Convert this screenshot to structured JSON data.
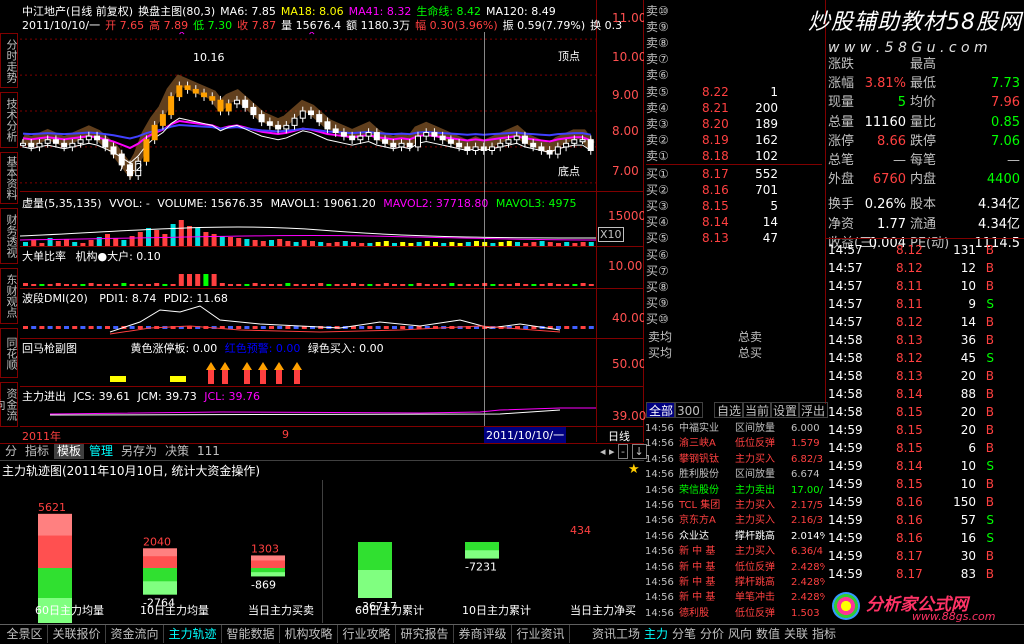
{
  "colors": {
    "up": "#ff4040",
    "down": "#00e0e0",
    "green": "#00ff00",
    "yellow": "#ffff00",
    "white": "#ffffff",
    "grid": "#800000",
    "magenta": "#ff00ff"
  },
  "watermark": {
    "text1": "炒股辅助教材",
    "text2": "58股网",
    "url": "w w w . 5 8 G u . c o m"
  },
  "logo": {
    "text": "分析家公式网",
    "url": "www.88gs.com"
  },
  "header": {
    "line1": [
      {
        "t": "中江地产(日线 前复权)",
        "c": "#ffffff"
      },
      {
        "t": "换盘主图(80,3)",
        "c": "#ffffff"
      },
      {
        "t": "MA6: 7.85",
        "c": "#ffffff"
      },
      {
        "t": "MA18: 8.06",
        "c": "#ffff00"
      },
      {
        "t": "MA41: 8.32",
        "c": "#ff00ff"
      },
      {
        "t": "生命线: 8.42",
        "c": "#00ff00"
      },
      {
        "t": "MA120: 8.49",
        "c": "#ffffff"
      }
    ],
    "line2": [
      {
        "t": "2011/10/10/一",
        "c": "#ffffff"
      },
      {
        "t": "开 7.65",
        "c": "#ff4040"
      },
      {
        "t": "高 7.89",
        "c": "#ff4040"
      },
      {
        "t": "低 7.30",
        "c": "#00ff00"
      },
      {
        "t": "收 7.87",
        "c": "#ff4040"
      },
      {
        "t": "量 15676.4",
        "c": "#ffffff"
      },
      {
        "t": "额 1180.3万",
        "c": "#ffffff"
      },
      {
        "t": "幅 0.30(3.96%)",
        "c": "#ff4040"
      },
      {
        "t": "振 0.59(7.79%)",
        "c": "#ffffff"
      },
      {
        "t": "换 0.3",
        "c": "#ffffff"
      }
    ]
  },
  "main_chart": {
    "high_label": "10.16",
    "low_label": "7.12",
    "top_label": "顶点",
    "bottom_label": "底点",
    "scale": [
      "11.00",
      "10.00",
      "9.00",
      "8.00",
      "7.00"
    ]
  },
  "left_tabs": [
    "分时走势",
    "技术分析",
    "基本资料",
    "财务透视",
    "东财观点",
    "同花顺",
    "资金流向"
  ],
  "vol_panel": {
    "title": "虚量(5,35,135)",
    "vol": "VVOL: -",
    "volume": "VOLUME: 15676.35",
    "mav1": "MAVOL1: 19061.20",
    "mav2": "MAVOL2: 37718.80",
    "mav3": "MAVOL3: 4975",
    "scale": "15000",
    "x10": "X10"
  },
  "big_panel": {
    "title": "大单比率",
    "sub": "机构●大户: 0.10",
    "scale": "10.00"
  },
  "dmi_panel": {
    "title": "波段DMI(20)",
    "pdi1": "PDI1: 8.74",
    "pdi2": "PDI2: 11.68",
    "scale": "40.00"
  },
  "horse_panel": {
    "title": "回马枪副图",
    "yellow": "黄色涨停板: 0.00",
    "red": "红色预警: 0.00",
    "green": "绿色买入: 0.00",
    "scale": "50.00"
  },
  "main_flow": {
    "title": "主力进出",
    "jcs": "JCS: 39.61",
    "jcm": "JCM: 39.73",
    "jcl": "JCL: 39.76",
    "scale": "39.00"
  },
  "date_bar": {
    "start": "2011年",
    "mid": "9",
    "end": "2011/10/10/一",
    "period": "日线"
  },
  "bottom_tabs": [
    {
      "t": "分",
      "c": "#c0c0c0"
    },
    {
      "t": "指标",
      "c": "#c0c0c0"
    },
    {
      "t": "模板",
      "c": "#ffffff",
      "bg": "#404040"
    },
    {
      "t": "管理",
      "c": "#00ffff"
    },
    {
      "t": "另存为",
      "c": "#c0c0c0"
    },
    {
      "t": "决策",
      "c": "#c0c0c0"
    },
    {
      "t": "111",
      "c": "#c0c0c0"
    }
  ],
  "flow_panel": {
    "title": "主力轨迹图(2011年10月10日, 统计大资金操作)"
  },
  "chart_data": [
    {
      "type": "bar",
      "categories": [
        "60日主力均量",
        "10日主力均量",
        "当日主力买卖"
      ],
      "series": [
        {
          "values": [
            5621,
            2040,
            1303
          ]
        },
        {
          "values": [
            -6233,
            -2764,
            -869
          ]
        }
      ]
    },
    {
      "type": "bar",
      "categories": [
        "60日主力累计",
        "10日主力累计",
        "当日主力净买"
      ],
      "series": [
        {
          "values": [
            0,
            0,
            434
          ]
        },
        {
          "values": [
            -36717,
            -7231,
            0
          ]
        }
      ]
    }
  ],
  "bottom_nav": [
    "全景区",
    "关联报价",
    "资金流向",
    "主力轨迹",
    "智能数据",
    "机构攻略",
    "行业攻略",
    "研究报告",
    "券商评级",
    "行业资讯"
  ],
  "bottom_nav_right": [
    "资讯工场",
    "主力",
    "分笔",
    "分价",
    "风向",
    "数值",
    "关联",
    "指标"
  ],
  "order_book": {
    "sell": [
      {
        "l": "卖⑩",
        "p": "",
        "v": ""
      },
      {
        "l": "卖⑨",
        "p": "",
        "v": ""
      },
      {
        "l": "卖⑧",
        "p": "",
        "v": ""
      },
      {
        "l": "卖⑦",
        "p": "",
        "v": ""
      },
      {
        "l": "卖⑥",
        "p": "",
        "v": ""
      },
      {
        "l": "卖⑤",
        "p": "8.22",
        "v": "1"
      },
      {
        "l": "卖④",
        "p": "8.21",
        "v": "200"
      },
      {
        "l": "卖③",
        "p": "8.20",
        "v": "189"
      },
      {
        "l": "卖②",
        "p": "8.19",
        "v": "162"
      },
      {
        "l": "卖①",
        "p": "8.18",
        "v": "102"
      }
    ],
    "buy": [
      {
        "l": "买①",
        "p": "8.17",
        "v": "552"
      },
      {
        "l": "买②",
        "p": "8.16",
        "v": "701"
      },
      {
        "l": "买③",
        "p": "8.15",
        "v": "5"
      },
      {
        "l": "买④",
        "p": "8.14",
        "v": "14"
      },
      {
        "l": "买⑤",
        "p": "8.13",
        "v": "47"
      },
      {
        "l": "买⑥",
        "p": "",
        "v": ""
      },
      {
        "l": "买⑦",
        "p": "",
        "v": ""
      },
      {
        "l": "买⑧",
        "p": "",
        "v": ""
      },
      {
        "l": "买⑨",
        "p": "",
        "v": ""
      },
      {
        "l": "买⑩",
        "p": "",
        "v": ""
      }
    ],
    "avg_sell": "卖均",
    "total_sell": "总卖",
    "avg_buy": "买均",
    "total_buy": "总买"
  },
  "news_tabs": [
    "全部",
    "300",
    "自选",
    "当前",
    "设置",
    "浮出"
  ],
  "news": [
    {
      "t": "14:56",
      "n": "中福实业",
      "s": "区间放量",
      "v": "6.000",
      "c": "#c0c0c0"
    },
    {
      "t": "14:56",
      "n": "渝三峡A",
      "s": "低位反弹",
      "v": "1.579",
      "c": "#ff4040"
    },
    {
      "t": "14:56",
      "n": "攀钢钒钛",
      "s": "主力买入",
      "v": "6.82/3",
      "c": "#ff4040"
    },
    {
      "t": "14:56",
      "n": "胜利股份",
      "s": "区间放量",
      "v": "6.674",
      "c": "#c0c0c0"
    },
    {
      "t": "14:56",
      "n": "荣信股份",
      "s": "主力卖出",
      "v": "17.00/",
      "c": "#00ff00"
    },
    {
      "t": "14:56",
      "n": "TCL 集团",
      "s": "主力买入",
      "v": "2.17/5",
      "c": "#ff4040"
    },
    {
      "t": "14:56",
      "n": "京东方A",
      "s": "主力买入",
      "v": "2.16/3",
      "c": "#ff4040"
    },
    {
      "t": "14:56",
      "n": "众业达",
      "s": "撑杆跳高",
      "v": "2.014%",
      "c": "#ffffff"
    },
    {
      "t": "14:56",
      "n": "新 中 基",
      "s": "主力买入",
      "v": "6.36/4",
      "c": "#ff4040"
    },
    {
      "t": "14:56",
      "n": "新 中 基",
      "s": "低位反弹",
      "v": "2.428%",
      "c": "#ff4040"
    },
    {
      "t": "14:56",
      "n": "新 中 基",
      "s": "撑杆跳高",
      "v": "2.428%",
      "c": "#ff4040"
    },
    {
      "t": "14:56",
      "n": "新 中 基",
      "s": "单笔冲击",
      "v": "2.428%",
      "c": "#ff4040"
    },
    {
      "t": "14:56",
      "n": "德利股",
      "s": "低位反弹",
      "v": "1.503",
      "c": "#ff4040"
    }
  ],
  "quote": {
    "rows": [
      {
        "k1": "涨跌",
        "v1": "",
        "k2": "最高",
        "v2": "",
        "c1": "#ff4040",
        "c2": "#ff4040"
      },
      {
        "k1": "涨幅",
        "v1": "3.81%",
        "k2": "最低",
        "v2": "7.73",
        "c1": "#ff4040",
        "c2": "#00ff00"
      },
      {
        "k1": "现量",
        "v1": "5",
        "k2": "均价",
        "v2": "7.96",
        "c1": "#00ff00",
        "c2": "#ff4040"
      },
      {
        "k1": "总量",
        "v1": "11160",
        "k2": "量比",
        "v2": "0.85",
        "c1": "#ffffff",
        "c2": "#00ff00"
      },
      {
        "k1": "涨停",
        "v1": "8.66",
        "k2": "跌停",
        "v2": "7.06",
        "c1": "#ff4040",
        "c2": "#00ff00"
      },
      {
        "k1": "总笔",
        "v1": "—",
        "k2": "每笔",
        "v2": "—",
        "c1": "#c0c0c0",
        "c2": "#c0c0c0"
      },
      {
        "k1": "外盘",
        "v1": "6760",
        "k2": "内盘",
        "v2": "4400",
        "c1": "#ff4040",
        "c2": "#00ff00"
      },
      {
        "k1": "换手",
        "v1": "0.26%",
        "k2": "股本",
        "v2": "4.34亿",
        "c1": "#ffffff",
        "c2": "#ffffff"
      },
      {
        "k1": "净资",
        "v1": "1.77",
        "k2": "流通",
        "v2": "4.34亿",
        "c1": "#ffffff",
        "c2": "#ffffff"
      },
      {
        "k1": "收益(三)",
        "v1": "0.004",
        "k2": "PE(动)",
        "v2": "1114.5",
        "c1": "#ffffff",
        "c2": "#ffffff"
      }
    ]
  },
  "ticks": [
    {
      "t": "14:57",
      "p": "8.12",
      "v": "131",
      "d": "B"
    },
    {
      "t": "14:57",
      "p": "8.12",
      "v": "12",
      "d": "B"
    },
    {
      "t": "14:57",
      "p": "8.11",
      "v": "10",
      "d": "B"
    },
    {
      "t": "14:57",
      "p": "8.11",
      "v": "9",
      "d": "S"
    },
    {
      "t": "14:57",
      "p": "8.12",
      "v": "14",
      "d": "B"
    },
    {
      "t": "14:58",
      "p": "8.13",
      "v": "36",
      "d": "B"
    },
    {
      "t": "14:58",
      "p": "8.12",
      "v": "45",
      "d": "S"
    },
    {
      "t": "14:58",
      "p": "8.13",
      "v": "20",
      "d": "B"
    },
    {
      "t": "14:58",
      "p": "8.14",
      "v": "88",
      "d": "B"
    },
    {
      "t": "14:58",
      "p": "8.15",
      "v": "20",
      "d": "B"
    },
    {
      "t": "14:59",
      "p": "8.15",
      "v": "20",
      "d": "B"
    },
    {
      "t": "14:59",
      "p": "8.15",
      "v": "6",
      "d": "B"
    },
    {
      "t": "14:59",
      "p": "8.14",
      "v": "10",
      "d": "S"
    },
    {
      "t": "14:59",
      "p": "8.15",
      "v": "10",
      "d": "B"
    },
    {
      "t": "14:59",
      "p": "8.16",
      "v": "150",
      "d": "B"
    },
    {
      "t": "14:59",
      "p": "8.16",
      "v": "57",
      "d": "S"
    },
    {
      "t": "14:59",
      "p": "8.16",
      "v": "16",
      "d": "S"
    },
    {
      "t": "14:59",
      "p": "8.17",
      "v": "30",
      "d": "B"
    },
    {
      "t": "14:59",
      "p": "8.17",
      "v": "83",
      "d": "B"
    }
  ]
}
